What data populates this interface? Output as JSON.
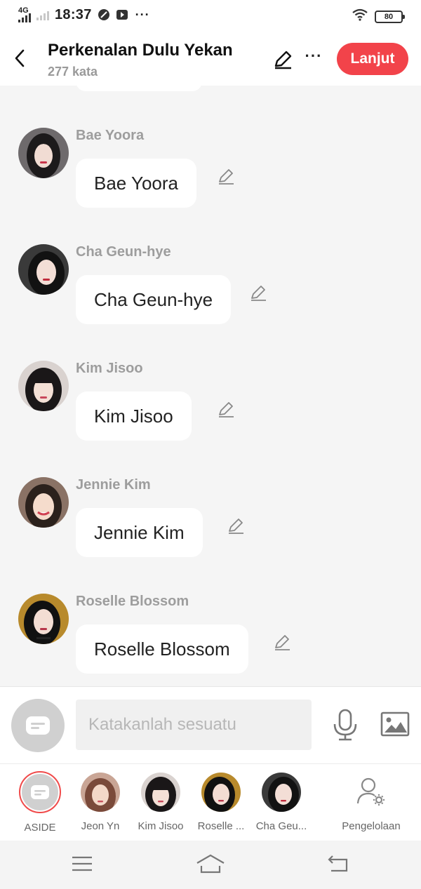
{
  "status_bar": {
    "network": "4G",
    "time": "18:37",
    "battery": "80"
  },
  "header": {
    "title": "Perkenalan Dulu Yekan",
    "subtitle": "277 kata",
    "next_label": "Lanjut"
  },
  "messages": [
    {
      "sender": "Bae Yoora",
      "text": "Bae Yoora"
    },
    {
      "sender": "Cha Geun-hye",
      "text": "Cha Geun-hye"
    },
    {
      "sender": "Kim Jisoo",
      "text": "Kim Jisoo"
    },
    {
      "sender": "Jennie Kim",
      "text": "Jennie Kim"
    },
    {
      "sender": "Roselle Blossom",
      "text": "Roselle Blossom"
    }
  ],
  "composer": {
    "placeholder": "Katakanlah sesuatu"
  },
  "characters": [
    {
      "name": "ASIDE"
    },
    {
      "name": "Jeon Yn"
    },
    {
      "name": "Kim Jisoo"
    },
    {
      "name": "Roselle ..."
    },
    {
      "name": "Cha Geu..."
    },
    {
      "name": "Pengelolaan"
    }
  ],
  "colors": {
    "accent": "#f2434a",
    "background": "#f5f5f5"
  }
}
